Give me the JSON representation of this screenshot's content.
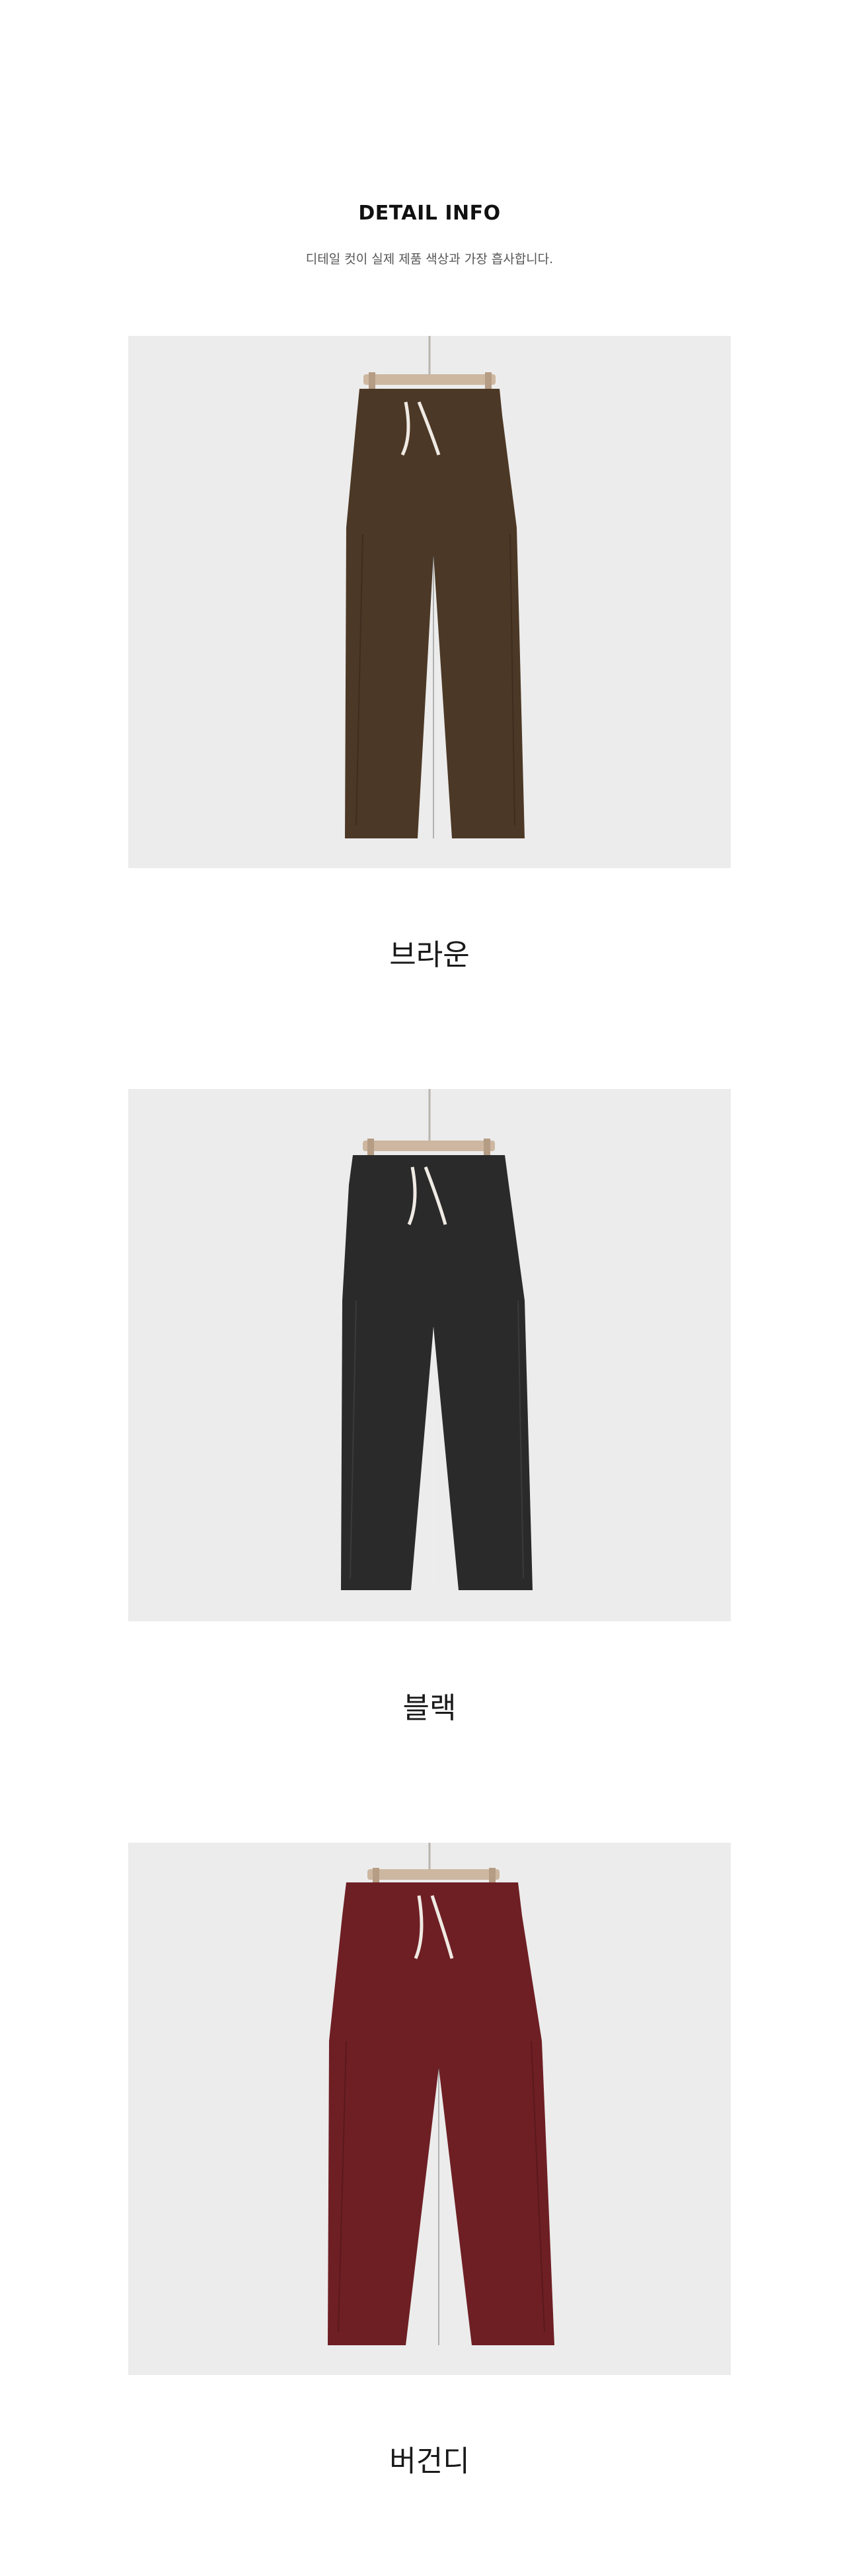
{
  "header": {
    "title": "DETAIL INFO",
    "subtitle": "디테일 컷이 실제 제품 색상과 가장 흡사합니다."
  },
  "products": [
    {
      "label": "브라운",
      "color": "#4c3826",
      "icon": "pants-image"
    },
    {
      "label": "블랙",
      "color": "#2a2a2a",
      "icon": "pants-image"
    },
    {
      "label": "버건디",
      "color": "#6e1f24",
      "icon": "pants-image"
    }
  ]
}
